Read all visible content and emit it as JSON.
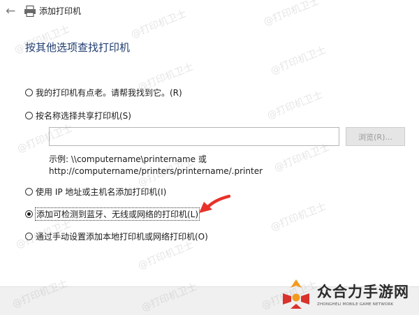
{
  "window": {
    "title": "添加打印机"
  },
  "page": {
    "heading": "按其他选项查找打印机"
  },
  "options": [
    {
      "label": "我的打印机有点老。请帮我找到它。(R)",
      "selected": false,
      "focused": false
    },
    {
      "label": "按名称选择共享打印机(S)",
      "selected": false,
      "focused": false
    },
    {
      "label": "使用 IP 地址或主机名添加打印机(I)",
      "selected": false,
      "focused": false
    },
    {
      "label": "添加可检测到蓝牙、无线或网络的打印机(L)",
      "selected": true,
      "focused": true
    },
    {
      "label": "通过手动设置添加本地打印机或网络打印机(O)",
      "selected": false,
      "focused": false
    }
  ],
  "share_name": {
    "value": "",
    "browse_label": "浏览(R)..."
  },
  "example": {
    "line1": "示例: \\\\computername\\printername 或",
    "line2": "http://computername/printers/printername/.printer"
  },
  "watermark": "@打印机卫士",
  "brand": {
    "name": "众合力手游网",
    "subtitle": "ZHONGHELI MOBILE GAME NETWORK"
  },
  "icons": {
    "back": "back-arrow-icon",
    "printer": "printer-icon",
    "annotation": "red-arrow-annotation"
  },
  "colors": {
    "heading": "#1e3b6f",
    "annotation": "#e8312a",
    "logo_orange": "#f29a1f",
    "logo_red": "#d9322b"
  }
}
